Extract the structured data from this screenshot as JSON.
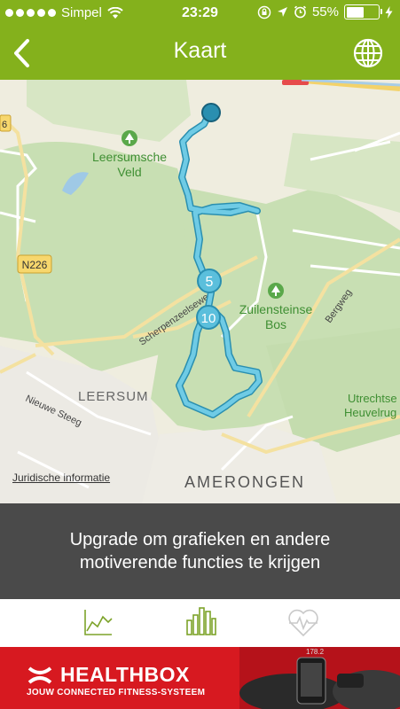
{
  "status_bar": {
    "carrier": "Simpel",
    "time": "23:29",
    "battery": "55%",
    "battery_level": 0.55,
    "signal_bars": 5
  },
  "nav": {
    "title": "Kaart",
    "back_icon": "chevron-left-icon",
    "globe_icon": "globe-icon"
  },
  "map": {
    "labels": {
      "leersumsche_veld_1": "Leersumsche",
      "leersumsche_veld_2": "Veld",
      "zuilensteinse_1": "Zuilensteinse",
      "zuilensteinse_2": "Bos",
      "n226": "N226",
      "scherpenzeelseweg": "Scherpenzeelseweg",
      "bergweg": "Bergweg",
      "leersum": "LEERSUM",
      "nieuwe_steeg": "Nieuwe Steeg",
      "utrechtse_1": "Utrechtse",
      "utrechtse_2": "Heuvelrug",
      "amerongen": "AMERONGEN",
      "edge_road": "6"
    },
    "markers": [
      "5",
      "10"
    ],
    "legal_link": "Juridische informatie",
    "route_color": "#5bbfdc"
  },
  "upgrade": {
    "line1": "Upgrade om grafieken en andere",
    "line2": "motiverende functies te krijgen"
  },
  "tabs": [
    {
      "name": "line-chart-icon",
      "active": true
    },
    {
      "name": "bar-chart-icon",
      "active": true
    },
    {
      "name": "heart-rate-icon",
      "active": false
    }
  ],
  "ad": {
    "brand": "HEALTHBOX",
    "tagline": "JOUW CONNECTED FITNESS-SYSTEEM"
  },
  "colors": {
    "brand_green": "#84b11c",
    "banner_gray": "#4a4a4a",
    "ad_red": "#d71920"
  }
}
